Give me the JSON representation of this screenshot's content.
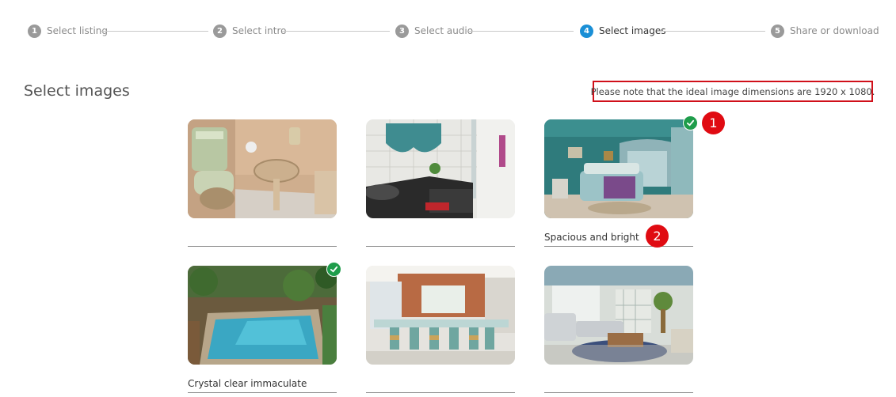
{
  "stepper": {
    "steps": [
      {
        "num": "1",
        "label": "Select listing"
      },
      {
        "num": "2",
        "label": "Select intro"
      },
      {
        "num": "3",
        "label": "Select audio"
      },
      {
        "num": "4",
        "label": "Select images",
        "active": true
      },
      {
        "num": "5",
        "label": "Share or download"
      }
    ]
  },
  "header": {
    "title": "Select images",
    "note": "Please note that the ideal image dimensions are 1920 x 1080."
  },
  "images": [
    {
      "name": "bathroom",
      "caption": "",
      "selected": false
    },
    {
      "name": "kitchen",
      "caption": "",
      "selected": false
    },
    {
      "name": "bedroom",
      "caption": "Spacious and bright",
      "selected": true
    },
    {
      "name": "pool",
      "caption": "Crystal clear immaculate",
      "selected": true
    },
    {
      "name": "patio",
      "caption": "",
      "selected": false
    },
    {
      "name": "lounge",
      "caption": "",
      "selected": false
    }
  ],
  "annotations": {
    "marker1": "1",
    "marker2": "2"
  },
  "colors": {
    "accent": "#1a8fd6",
    "selected_check": "#1f9d4b",
    "annotation_red": "#d0101a"
  }
}
